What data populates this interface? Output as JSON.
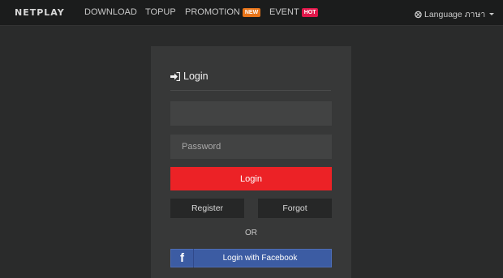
{
  "nav": {
    "logo": "NETPLAY",
    "download": "DOWNLOAD",
    "topup": "TOPUP",
    "promotion": "PROMOTION",
    "promotion_badge": "NEW",
    "event": "EVENT",
    "event_badge": "HOT",
    "language_label": "Language ภาษา"
  },
  "login": {
    "title": "Login",
    "username_placeholder": "",
    "password_placeholder": "Password",
    "submit": "Login",
    "register": "Register",
    "forgot": "Forgot",
    "or": "OR",
    "facebook": "Login with Facebook",
    "facebook_icon": "f"
  },
  "colors": {
    "background": "#2a2b2b",
    "navbar": "#1b1c1c",
    "panel": "#373838",
    "login_button": "#ec2226",
    "facebook": "#3c5ca3",
    "badge_new": "#e8751a",
    "badge_hot": "#e0174a"
  },
  "icons": {
    "login_title": "sign-in-icon",
    "language": "flag-icon",
    "facebook": "facebook-icon"
  }
}
